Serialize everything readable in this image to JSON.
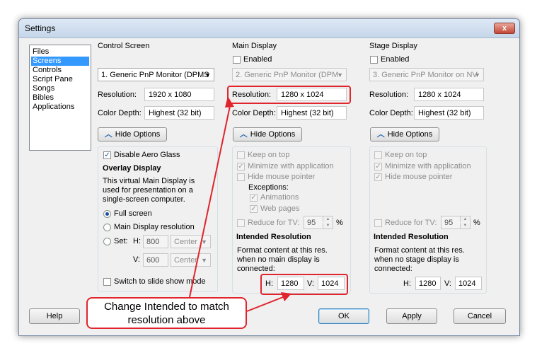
{
  "window": {
    "title": "Settings",
    "close_glyph": "x"
  },
  "sidebar": {
    "items": [
      "Files",
      "Screens",
      "Controls",
      "Script Pane",
      "Songs",
      "Bibles",
      "Applications"
    ],
    "selected": "Screens"
  },
  "control": {
    "title": "Control Screen",
    "monitor": "1. Generic PnP Monitor (DPMS",
    "resolution_label": "Resolution:",
    "resolution": "1920 x 1080",
    "color_label": "Color Depth:",
    "color": "Highest (32 bit)",
    "hide_options": "Hide Options",
    "disable_aero": "Disable Aero Glass",
    "overlay_title": "Overlay Display",
    "overlay_desc1": "This virtual Main Display is",
    "overlay_desc2": "used for presentation on a",
    "overlay_desc3": "single-screen computer.",
    "full_screen": "Full screen",
    "main_res": "Main Display resolution",
    "set": "Set:",
    "h_label": "H:",
    "h_value": "800",
    "v_label": "V:",
    "v_value": "600",
    "align": "Center",
    "slideshow": "Switch to slide show mode"
  },
  "main": {
    "title": "Main Display",
    "enabled": "Enabled",
    "monitor": "2. Generic PnP Monitor (DPM",
    "resolution_label": "Resolution:",
    "resolution": "1280 x 1024",
    "color_label": "Color Depth:",
    "color": "Highest (32 bit)",
    "hide_options": "Hide Options",
    "keep_on_top": "Keep on top",
    "minimize": "Minimize with application",
    "hide_mouse": "Hide mouse pointer",
    "exceptions": "Exceptions:",
    "animations": "Animations",
    "web_pages": "Web pages",
    "reduce": "Reduce for TV:",
    "reduce_value": "95",
    "percent": "%",
    "intended": "Intended Resolution",
    "format1": "Format content at this res.",
    "format2": "when no main display is",
    "format3": "connected:",
    "h_label": "H:",
    "h_value": "1280",
    "v_label": "V:",
    "v_value": "1024"
  },
  "stage": {
    "title": "Stage Display",
    "enabled": "Enabled",
    "monitor": "3. Generic PnP Monitor on NV",
    "resolution_label": "Resolution:",
    "resolution": "1280 x 1024",
    "color_label": "Color Depth:",
    "color": "Highest (32 bit)",
    "hide_options": "Hide Options",
    "keep_on_top": "Keep on top",
    "minimize": "Minimize with application",
    "hide_mouse": "Hide mouse pointer",
    "reduce": "Reduce for TV:",
    "reduce_value": "95",
    "percent": "%",
    "intended": "Intended Resolution",
    "format1": "Format content at this res.",
    "format2": "when no stage display is",
    "format3": "connected:",
    "h_label": "H:",
    "h_value": "1280",
    "v_label": "V:",
    "v_value": "1024"
  },
  "buttons": {
    "help": "Help",
    "ok": "OK",
    "apply": "Apply",
    "cancel": "Cancel"
  },
  "annotation": {
    "line1": "Change Intended to match",
    "line2": "resolution above"
  },
  "colors": {
    "annotation_red": "#e0252d",
    "selection_blue": "#3399ff"
  }
}
